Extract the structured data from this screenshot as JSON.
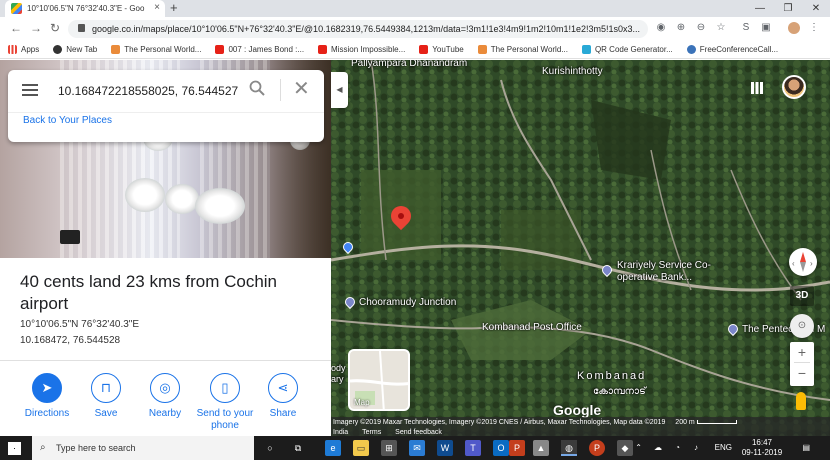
{
  "browser": {
    "tab_title": "10°10'06.5\"N 76°32'40.3\"E - Goo",
    "url": "google.co.in/maps/place/10°10'06.5\"N+76°32'40.3\"E/@10.1682319,76.5449384,1213m/data=!3m1!1e3!4m9!1m2!10m1!1e2!3m5!1s0x3...",
    "bookmarks": [
      "Apps",
      "New Tab",
      "The Personal World...",
      "007 : James Bond :...",
      "Mission Impossible...",
      "YouTube",
      "The Personal World...",
      "QR Code Generator...",
      "FreeConferenceCall..."
    ]
  },
  "search": {
    "query": "10.168472218558025, 76.544527",
    "back_link": "Back to Your Places"
  },
  "place": {
    "title": "40 cents land 23 kms from Cochin airport",
    "dms": "10°10'06.5\"N 76°32'40.3\"E",
    "decimal": "10.168472, 76.544528"
  },
  "actions": [
    {
      "label": "Directions",
      "icon": "directions-icon"
    },
    {
      "label": "Save",
      "icon": "bookmark-icon"
    },
    {
      "label": "Nearby",
      "icon": "nearby-icon"
    },
    {
      "label": "Send to your phone",
      "icon": "send-to-phone-icon"
    },
    {
      "label": "Share",
      "icon": "share-icon"
    }
  ],
  "map": {
    "labels": {
      "top": "Pallyampara Dhanandram",
      "kurishinthotty": "Kurishinthotty",
      "krariyely": "Krariyely Service Co-operative Bank...",
      "chooramudy": "Chooramudy Junction",
      "kombanad_po": "Kombanad Post Office",
      "pentecostal": "The Pentecostal M",
      "kombanad": "Kombanad",
      "kombanad_ml": "കോമ്പനാട്",
      "left_partial": "ody ary"
    },
    "controls": {
      "view3d": "3D",
      "zoom_in": "+",
      "zoom_out": "−"
    },
    "minimap_label": "Map",
    "google": "Google",
    "attribution": "Imagery ©2019 Maxar Technologies, Imagery ©2019 CNES / Airbus, Maxar Technologies, Map data ©2019",
    "scale": "200 m",
    "footer_links": [
      "India",
      "Terms",
      "Send feedback"
    ]
  },
  "taskbar": {
    "search_placeholder": "Type here to search",
    "lang": "ENG",
    "time": "16:47",
    "date": "09-11-2019"
  }
}
